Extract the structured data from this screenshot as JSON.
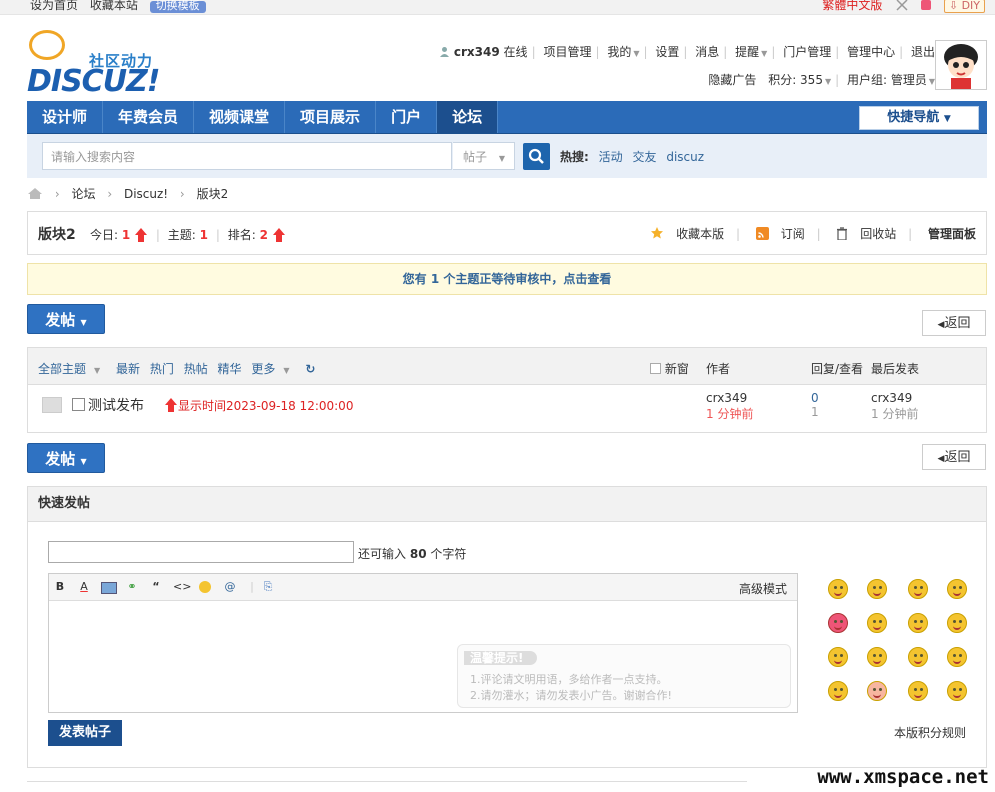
{
  "topbar": {
    "set_home": "设为首页",
    "bookmark": "收藏本站",
    "template": "切换模板",
    "traditional": "繁體中文版",
    "diy": "DIY"
  },
  "logo": {
    "cn": "社区动力",
    "en": "DISCUZ!"
  },
  "user": {
    "name": "crx349",
    "online": "在线",
    "links": [
      "项目管理",
      "我的",
      "设置",
      "消息",
      "提醒",
      "门户管理",
      "管理中心",
      "退出"
    ],
    "hide_ads": "隐藏广告",
    "credits": "积分: 355",
    "group": "用户组: 管理员"
  },
  "nav": {
    "items": [
      "设计师",
      "年费会员",
      "视频课堂",
      "项目展示",
      "门户",
      "论坛"
    ],
    "quick": "快捷导航"
  },
  "search": {
    "placeholder": "请输入搜索内容",
    "type": "帖子",
    "hot_label": "热搜:",
    "hot": [
      "活动",
      "交友",
      "discuz"
    ]
  },
  "breadcrumb": [
    "论坛",
    "Discuz!",
    "版块2"
  ],
  "forum": {
    "name": "版块2",
    "today_label": "今日:",
    "today": "1",
    "threads_label": "主题:",
    "threads": "1",
    "rank_label": "排名:",
    "rank": "2",
    "tools": [
      "收藏本版",
      "订阅",
      "回收站",
      "管理面板"
    ]
  },
  "notice": {
    "pre": "您有",
    "count": "1",
    "post": "个主题正等待审核中，点击查看"
  },
  "buttons": {
    "post": "发帖",
    "back": "返回"
  },
  "list": {
    "filters": [
      "全部主题",
      "最新",
      "热门",
      "热帖",
      "精华",
      "更多"
    ],
    "new_window": "新窗",
    "cols": {
      "author": "作者",
      "replies": "回复/查看",
      "last": "最后发表"
    },
    "rows": [
      {
        "subject": "测试发布",
        "display_time": "显示时间2023-09-18 12:00:00",
        "author": "crx349",
        "author_time": "1 分钟前",
        "replies": "0",
        "views": "1",
        "last_user": "crx349",
        "last_time": "1 分钟前"
      }
    ]
  },
  "fastpost": {
    "title": "快速发帖",
    "remain_pre": "还可输入",
    "remain": "80",
    "remain_post": "个字符",
    "advanced": "高级模式",
    "tips_title": "温馨提示!",
    "tips": [
      "1.评论请文明用语，多给作者一点支持。",
      "2.请勿灌水；请勿发表小广告。谢谢合作!"
    ],
    "submit": "发表帖子",
    "rules": "本版积分规则"
  },
  "watermark": "www.xmspace.net",
  "colors": {
    "nav": "#2b6bb8",
    "accent": "#1c4f8e",
    "red": "#e33"
  }
}
